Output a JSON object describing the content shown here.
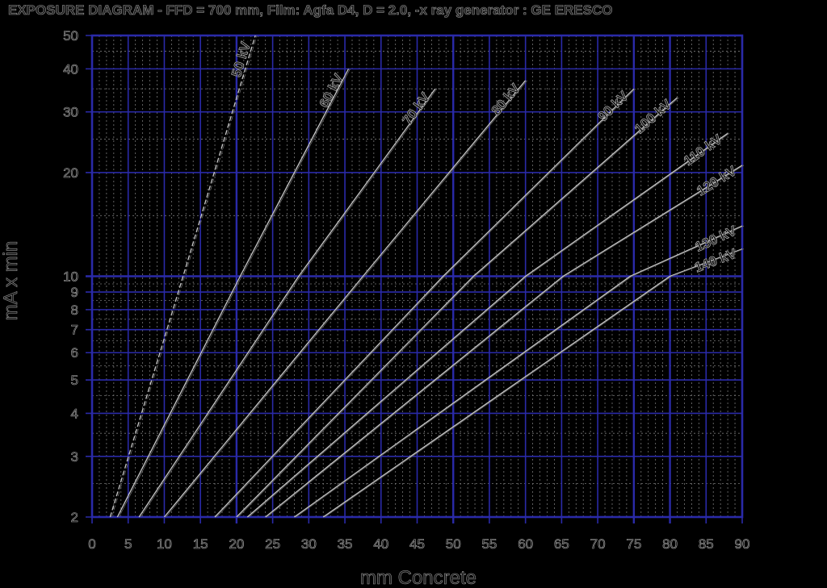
{
  "chart_data": {
    "type": "line",
    "title": "EXPOSURE DIAGRAM - FFD = 700 mm, Film: Agfa D4, D = 2.0, -x ray generator : GE ERESCO",
    "xlabel": "mm Concrete",
    "ylabel": "mA x min",
    "xlim": [
      0,
      90
    ],
    "ylim": [
      2,
      50
    ],
    "yscale": "log",
    "grid": true,
    "x_ticks": [
      0,
      5,
      10,
      15,
      20,
      25,
      30,
      35,
      40,
      45,
      50,
      55,
      60,
      65,
      70,
      75,
      80,
      85,
      90
    ],
    "y_ticks": [
      2,
      3,
      4,
      5,
      6,
      7,
      8,
      9,
      10,
      20,
      30,
      40,
      50
    ],
    "series": [
      {
        "name": "50 kV",
        "x": [
          2.5,
          12.6,
          22.6
        ],
        "y": [
          2,
          10,
          50
        ]
      },
      {
        "name": "60 kV",
        "x": [
          3.5,
          20.5,
          35.5
        ],
        "y": [
          2,
          10,
          40
        ]
      },
      {
        "name": "70 kV",
        "x": [
          6.5,
          28.6,
          47.5
        ],
        "y": [
          2,
          10,
          35
        ]
      },
      {
        "name": "80 kV",
        "x": [
          10.0,
          37.5,
          60.0
        ],
        "y": [
          2,
          10,
          37
        ]
      },
      {
        "name": "90 kV",
        "x": [
          17.0,
          48.6,
          75.0
        ],
        "y": [
          2,
          10,
          35
        ]
      },
      {
        "name": "100 kV",
        "x": [
          20.0,
          52.8,
          81.0
        ],
        "y": [
          2,
          10,
          33
        ]
      },
      {
        "name": "110 kV",
        "x": [
          21.5,
          60.0,
          88.0
        ],
        "y": [
          2,
          10,
          26
        ]
      },
      {
        "name": "120 kV",
        "x": [
          24.0,
          65.2,
          90.0
        ],
        "y": [
          2,
          10,
          21
        ]
      },
      {
        "name": "130 kV",
        "x": [
          28.0,
          74.5,
          90.0
        ],
        "y": [
          2,
          10,
          14
        ]
      },
      {
        "name": "140 kV",
        "x": [
          32.0,
          80.0,
          90.0
        ],
        "y": [
          2,
          10,
          12
        ]
      }
    ],
    "colors": {
      "background": "#000000",
      "grid": "#2a2aa8",
      "curve": "#c8c8c8",
      "text": "#111111"
    }
  }
}
